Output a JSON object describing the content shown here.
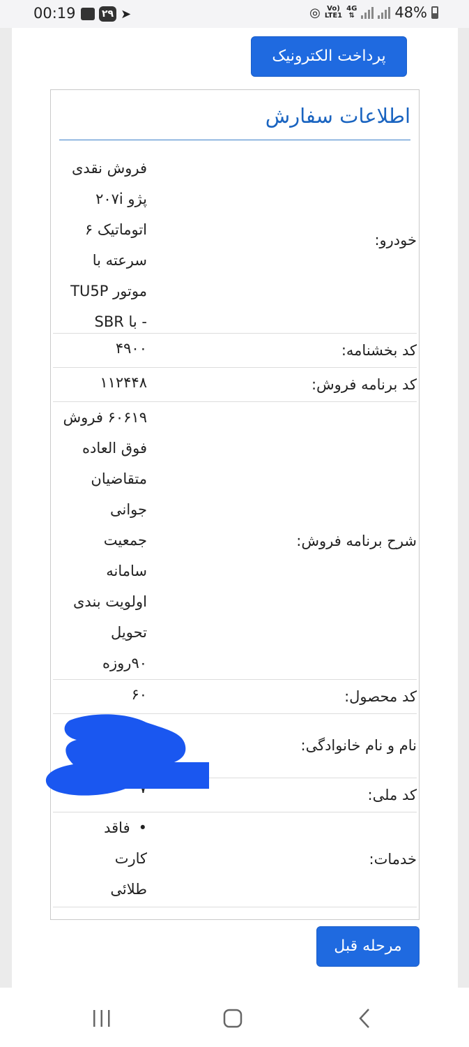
{
  "status_bar": {
    "time": "00:19",
    "badge": "۲۹",
    "battery": "48%",
    "net_top": "Vo)",
    "net_bottom": "LTE1",
    "net_gen": "4G"
  },
  "buttons": {
    "epay": "پرداخت الکترونیک",
    "prev": "مرحله قبل"
  },
  "card": {
    "title": "اطلاعات سفارش",
    "rows": {
      "car": {
        "label": "خودرو:",
        "lines": [
          "فروش نقدی",
          "پژو ۲۰۷i",
          "اتوماتیک ۶",
          "سرعته با",
          "موتور TU5P",
          "- با SBR"
        ]
      },
      "circular": {
        "label": "کد بخشنامه:",
        "lines": [
          "۴۹۰۰"
        ]
      },
      "program_code": {
        "label": "کد برنامه فروش:",
        "lines": [
          "۱۱۲۴۴۸"
        ]
      },
      "program_desc": {
        "label": "شرح برنامه فروش:",
        "lines": [
          "۶۰۶۱۹ فروش",
          "فوق العاده",
          "متقاضیان",
          "جوانی",
          "جمعیت",
          "سامانه",
          "اولویت بندی",
          "تحویل",
          "۹۰روزه"
        ]
      },
      "product_code": {
        "label": "کد محصول:",
        "lines": [
          "۶۰"
        ]
      },
      "full_name": {
        "label": "نام و نام خانوادگی:",
        "lines": []
      },
      "national_id": {
        "label": "کد ملی:",
        "lines": [
          "۷"
        ]
      },
      "services": {
        "label": "خدمات:",
        "lines": [
          "فاقد",
          "کارت",
          "طلائی"
        ]
      }
    }
  },
  "colors": {
    "primary": "#1f6ae0",
    "title": "#1a64c0",
    "scribble": "#1a57f0"
  }
}
